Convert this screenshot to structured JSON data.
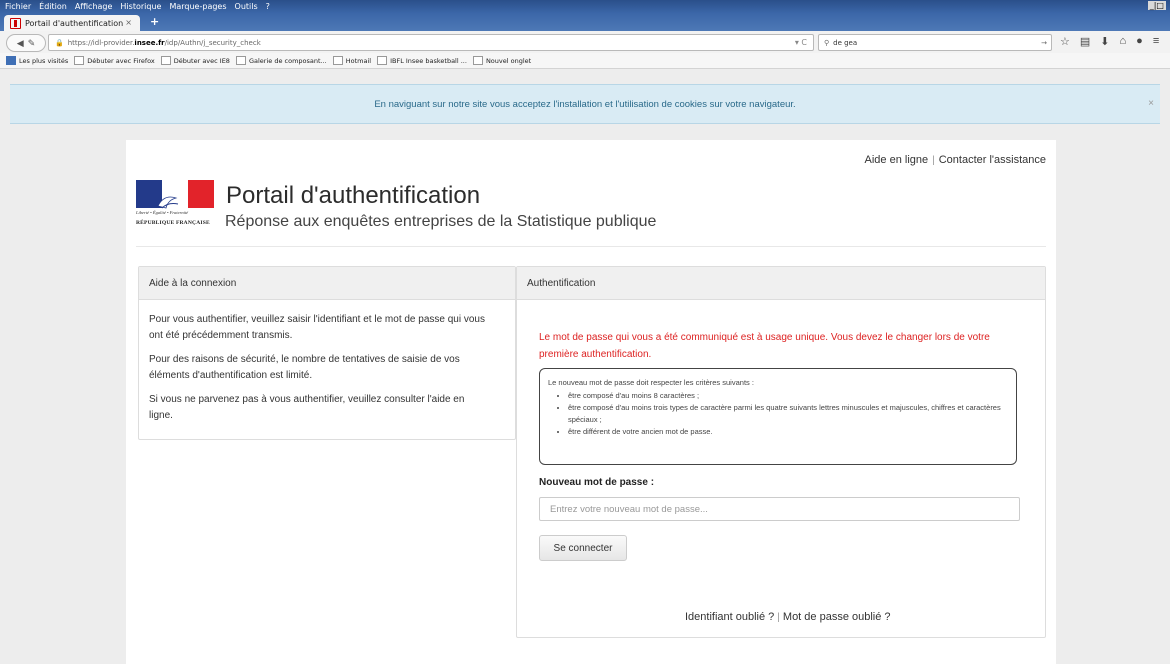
{
  "browser": {
    "menu": [
      "Fichier",
      "Édition",
      "Affichage",
      "Historique",
      "Marque-pages",
      "Outils",
      "?"
    ],
    "tab_title": "Portail d'authentification",
    "tab_close": "×",
    "new_tab": "+",
    "url_prefix": "https://idl-provider.",
    "url_host": "insee.fr",
    "url_path": "/idp/Authn/j_security_check",
    "search_value": "de gea",
    "bookmarks": [
      "Les plus visités",
      "Débuter avec Firefox",
      "Débuter avec IE8",
      "Galerie de composant...",
      "Hotmail",
      "IBFL Insee basketball ...",
      "Nouvel onglet"
    ]
  },
  "cookie_banner": {
    "text": "En naviguant sur notre site vous acceptez l'installation et l'utilisation de cookies sur votre navigateur.",
    "close": "×"
  },
  "header": {
    "help_link": "Aide en ligne",
    "contact_link": "Contacter l'assistance",
    "separator": "|",
    "title": "Portail d'authentification",
    "subtitle": "Réponse aux enquêtes entreprises de la Statistique publique",
    "motto": "Liberté • Égalité • Fraternité",
    "republic": "RÉPUBLIQUE FRANÇAISE"
  },
  "help_panel": {
    "heading": "Aide à la connexion",
    "paragraphs": [
      "Pour vous authentifier, veuillez saisir l'identifiant et le mot de passe qui vous ont été précédemment transmis.",
      "Pour des raisons de sécurité, le nombre de tentatives de saisie de vos éléments d'authentification est limité.",
      "Si vous ne parvenez pas à  vous authentifier, veuillez consulter l'aide en ligne."
    ]
  },
  "auth_panel": {
    "heading": "Authentification",
    "warning": "Le mot de passe qui vous a été communiqué est à usage unique. Vous devez le changer lors de votre première authentification.",
    "criteria_intro": "Le nouveau mot de passe doit respecter les critères suivants :",
    "criteria": [
      "être composé d'au moins 8 caractères ;",
      "être composé d'au moins trois types de caractère parmi les quatre suivants lettres minuscules et majuscules, chiffres et caractères spéciaux ;",
      "être différent de votre ancien mot de passe."
    ],
    "password_label": "Nouveau mot de passe :",
    "password_placeholder": "Entrez votre nouveau mot de passe...",
    "submit_label": "Se connecter",
    "forgot_id": "Identifiant oublié ?",
    "forgot_pw": "Mot de passe oublié ?",
    "separator": "|"
  }
}
